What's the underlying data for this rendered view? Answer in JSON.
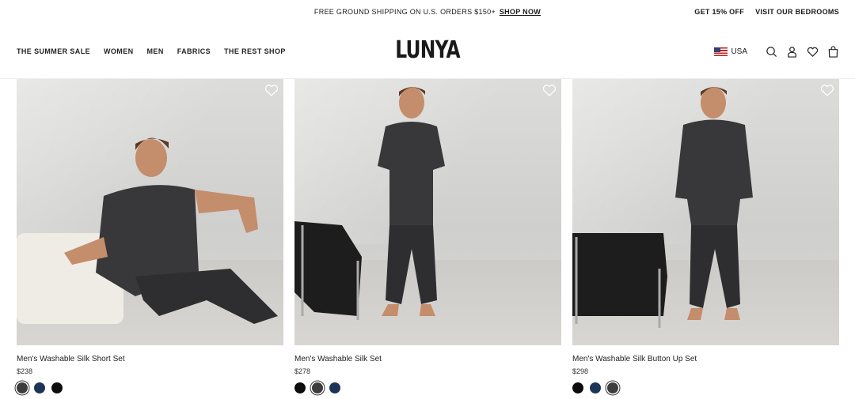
{
  "announcement": {
    "text": "FREE GROUND SHIPPING ON U.S. ORDERS $150+",
    "link": "SHOP NOW",
    "right_links": [
      "GET 15% OFF",
      "VISIT OUR BEDROOMS"
    ]
  },
  "header": {
    "nav": [
      "THE SUMMER SALE",
      "WOMEN",
      "MEN",
      "FABRICS",
      "THE REST SHOP"
    ],
    "logo": "LUNYA",
    "region": "USA",
    "icons": [
      "search-icon",
      "account-icon",
      "wishlist-icon",
      "cart-icon"
    ]
  },
  "products": [
    {
      "name": "Men's Washable Silk Short Set",
      "price": "$238",
      "swatches": [
        {
          "color": "#3d3d3d",
          "selected": true
        },
        {
          "color": "#1c3557",
          "selected": false
        },
        {
          "color": "#0d0d0d",
          "selected": false
        }
      ]
    },
    {
      "name": "Men's Washable Silk Set",
      "price": "$278",
      "swatches": [
        {
          "color": "#0d0d0d",
          "selected": false
        },
        {
          "color": "#3d3d3d",
          "selected": true
        },
        {
          "color": "#1c3557",
          "selected": false
        }
      ]
    },
    {
      "name": "Men's Washable Silk Button Up Set",
      "price": "$298",
      "swatches": [
        {
          "color": "#0d0d0d",
          "selected": false
        },
        {
          "color": "#1c3557",
          "selected": false
        },
        {
          "color": "#3d3d3d",
          "selected": true
        }
      ]
    }
  ]
}
